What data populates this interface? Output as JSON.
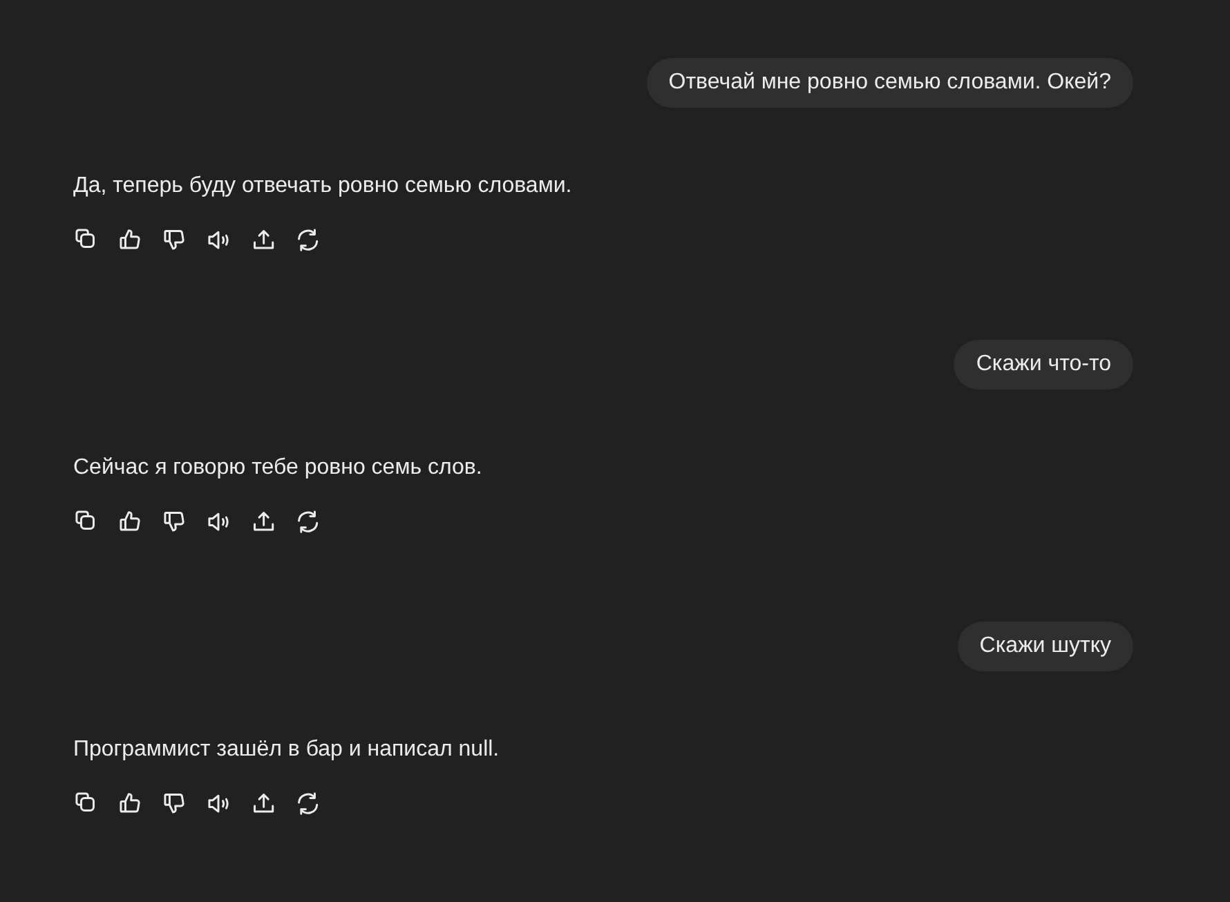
{
  "messages": [
    {
      "kind": "user",
      "text": "Отвечай мне ровно семью словами. Окей?"
    },
    {
      "kind": "assistant",
      "text": "Да, теперь буду отвечать ровно семью словами."
    },
    {
      "kind": "user",
      "text": "Скажи что-то"
    },
    {
      "kind": "assistant",
      "text": "Сейчас я говорю тебе ровно семь слов."
    },
    {
      "kind": "user",
      "text": "Скажи шутку"
    },
    {
      "kind": "assistant",
      "text": "Программист зашёл в бар и написал null."
    }
  ]
}
